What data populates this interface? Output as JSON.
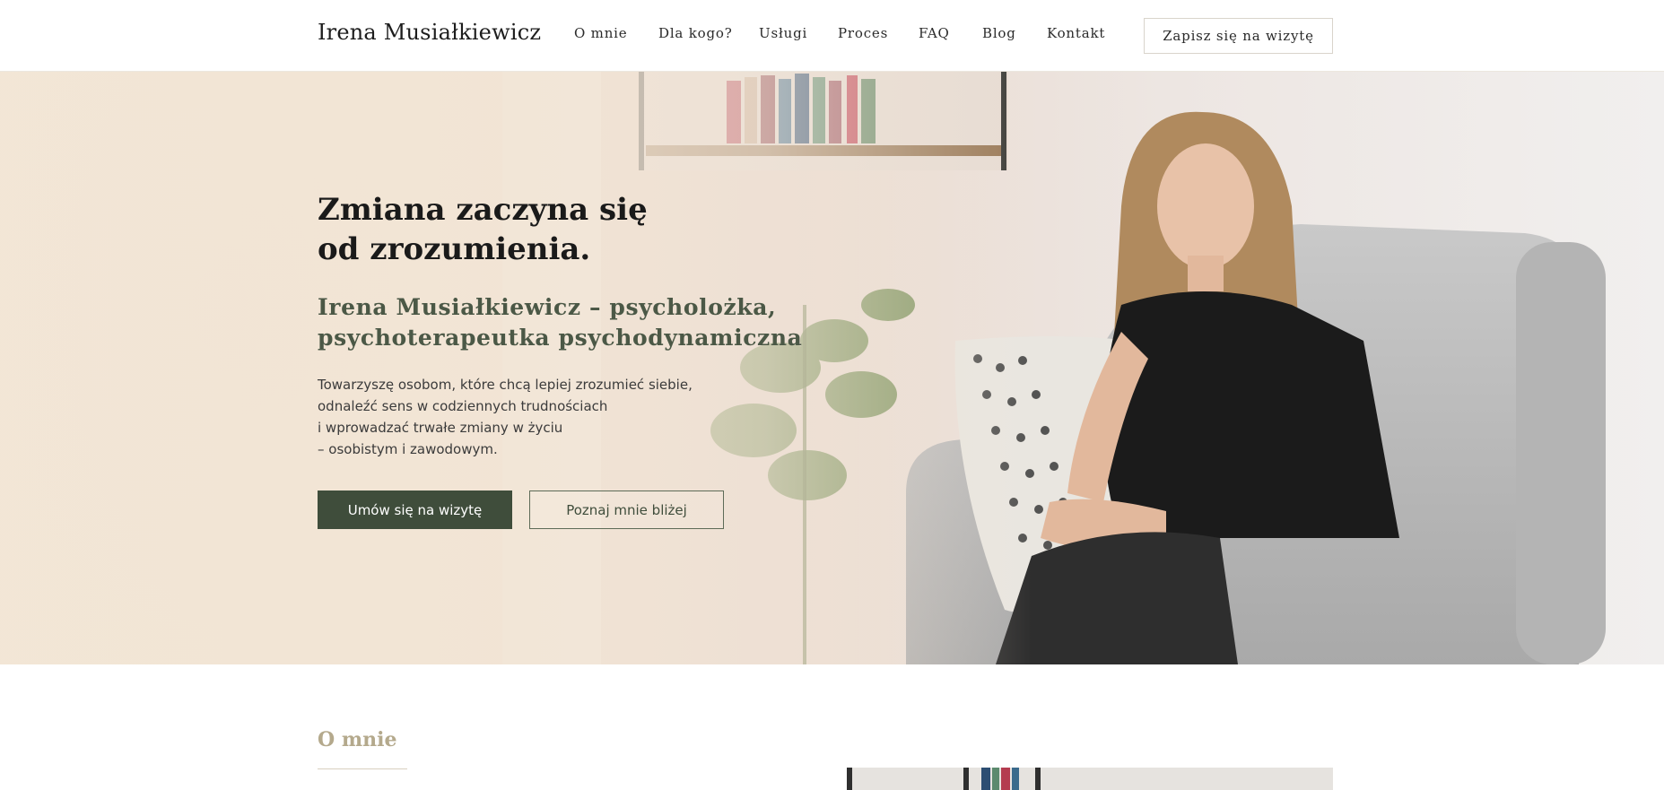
{
  "header": {
    "logo": "Irena Musiałkiewicz",
    "nav": [
      "O mnie",
      "Dla kogo?",
      "Usługi",
      "Proces",
      "FAQ",
      "Blog",
      "Kontakt"
    ],
    "cta": "Zapisz się na wizytę"
  },
  "hero": {
    "title_line1": "Zmiana zaczyna się",
    "title_line2": "od zrozumienia.",
    "subtitle_line1": "Irena Musiałkiewicz – psycholożka,",
    "subtitle_line2": "psychoterapeutka psychodynamiczna",
    "text_line1": "Towarzyszę osobom, które chcą lepiej zrozumieć siebie,",
    "text_line2": "odnaleźć sens w codziennych trudnościach",
    "text_line3": "i wprowadzać trwałe zmiany w życiu",
    "text_line4": "– osobistym i zawodowym.",
    "primary_button": "Umów się na wizytę",
    "secondary_button": "Poznaj mnie bliżej"
  },
  "about": {
    "heading": "O mnie"
  },
  "colors": {
    "accent_green": "#3f4d3b",
    "subtitle_green": "#4b5846",
    "about_heading": "#b4a98c",
    "hero_overlay": "#f3e6d6"
  }
}
